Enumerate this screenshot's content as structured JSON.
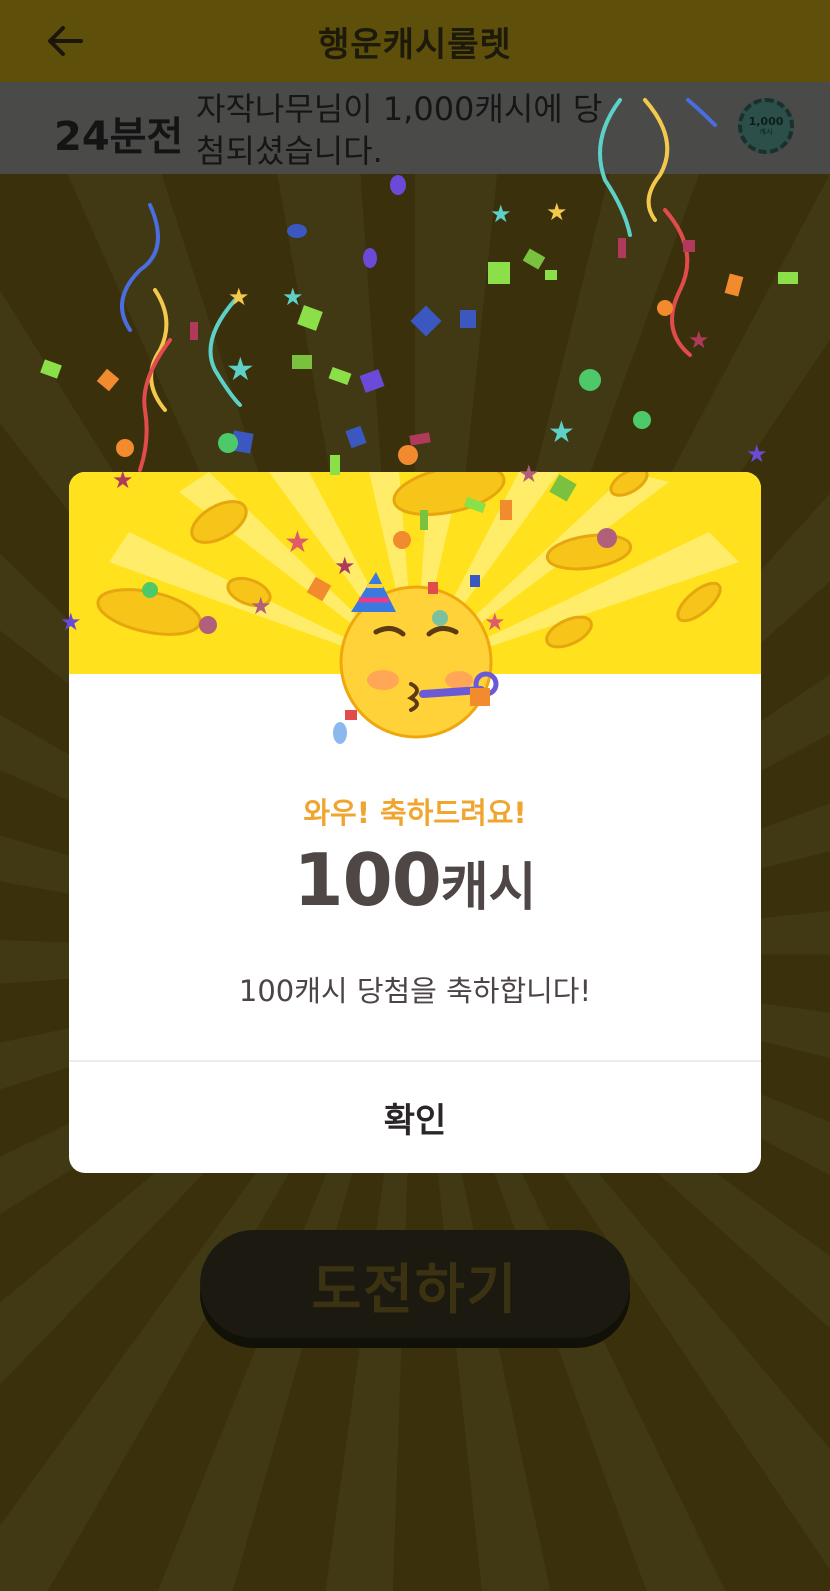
{
  "header": {
    "title": "행운캐시룰렛",
    "back_icon": "arrow-left-icon"
  },
  "ticker": {
    "time_ago": "24분전",
    "message": "자작나무님이 1,000캐시에 당첨되셨습니다.",
    "chip_amount": "1,000",
    "chip_unit": "캐시"
  },
  "challenge_button": {
    "label": "도전하기"
  },
  "modal": {
    "emoji": "partying-face-icon",
    "headline": "와우! 축하드려요!",
    "amount_number": "100",
    "amount_unit": "캐시",
    "message": "100캐시 당첨을 축하합니다!",
    "confirm_label": "확인"
  },
  "colors": {
    "banner_yellow": "#ffe21d",
    "headline_orange": "#f0a531",
    "amount_text": "#4f4646",
    "dim_overlay_bg": "#3a310c"
  }
}
